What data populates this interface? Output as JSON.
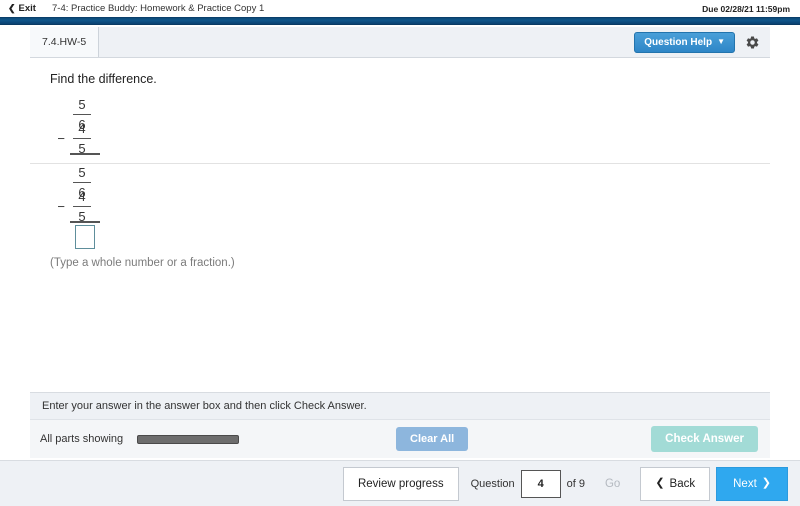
{
  "header": {
    "exit_label": "Exit",
    "back_chevron": "chevron-left-icon",
    "assignment_title": "7-4: Practice Buddy: Homework & Practice Copy 1",
    "due_date": "Due 02/28/21 11:59pm"
  },
  "exercise": {
    "tab_label": "7.4.HW-5",
    "question_help_label": "Question Help",
    "question_help_caret": "▼",
    "gear_icon": "gear-icon"
  },
  "problem": {
    "prompt": "Find the difference.",
    "statement": {
      "first_fraction": {
        "numerator": "5",
        "denominator": "6",
        "operator": ""
      },
      "second_fraction": {
        "numerator": "4",
        "denominator": "5",
        "operator": "−"
      }
    },
    "work": {
      "first_fraction": {
        "numerator": "5",
        "denominator": "6",
        "operator": ""
      },
      "second_fraction": {
        "numerator": "4",
        "denominator": "5",
        "operator": "−"
      },
      "answer_value": "",
      "answer_placeholder": ""
    },
    "typing_hint": "(Type a whole number or a fraction.)"
  },
  "answer_bar": {
    "instruction": "Enter your answer in the answer box and then click Check Answer.",
    "parts_status": "All parts showing",
    "progress_percent": 100,
    "clear_all_label": "Clear All",
    "check_answer_label": "Check Answer"
  },
  "bottom_nav": {
    "review_progress_label": "Review progress",
    "question_label": "Question",
    "question_number": "4",
    "of_label": "of 9",
    "go_label": "Go",
    "back_label": "Back",
    "back_arrow": "arrow-left-icon",
    "next_label": "Next",
    "next_arrow": "arrow-right-icon"
  },
  "colors": {
    "header_band": "#0c4a77",
    "question_help": "#2e86c7",
    "next_button": "#2fa8ef",
    "clear_all": "#8db6dd",
    "check_answer": "#a2dbd6",
    "answer_box_border": "#5e8e9b"
  }
}
